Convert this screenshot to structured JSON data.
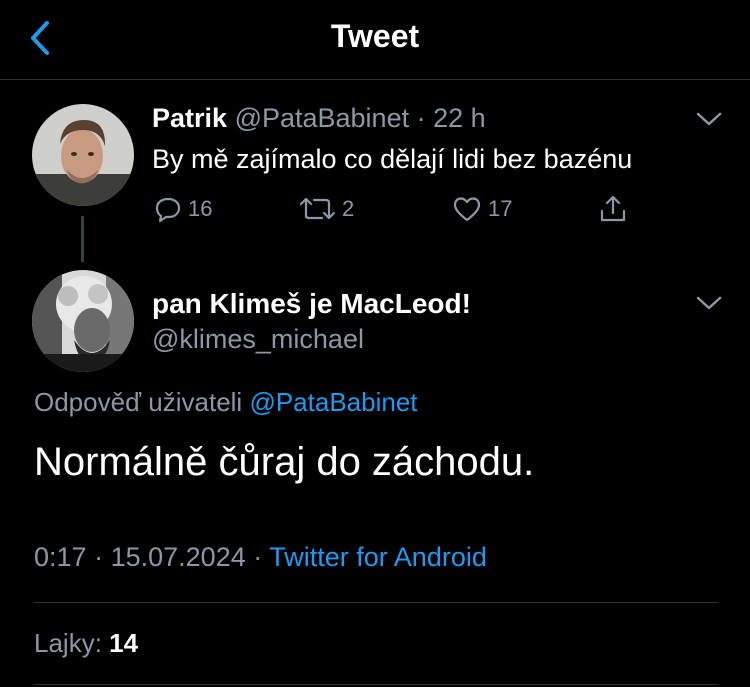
{
  "header": {
    "title": "Tweet",
    "back_icon": "chevron-left-icon"
  },
  "colors": {
    "background": "#000000",
    "accent": "#1d9bf0",
    "muted": "#8b98a5",
    "divider": "#2f3336"
  },
  "parent_tweet": {
    "author_name": "Patrik",
    "author_handle": "@PataBabinet",
    "separator": "·",
    "time_ago": "22 h",
    "text": "By mě zajímalo co dělají lidi bez bazénu",
    "actions": {
      "replies": "16",
      "retweets": "2",
      "likes": "17"
    }
  },
  "reply_tweet": {
    "author_name": "pan Klimeš je MacLeod!",
    "author_handle": "@klimes_michael",
    "reply_prefix": "Odpověď uživateli",
    "reply_target": "@PataBabinet",
    "text": "Normálně čůraj do záchodu.",
    "time": "0:17",
    "date": "15.07.2024",
    "separator": "·",
    "source": "Twitter for Android",
    "likes_label": "Lajky:",
    "likes_count": "14"
  }
}
